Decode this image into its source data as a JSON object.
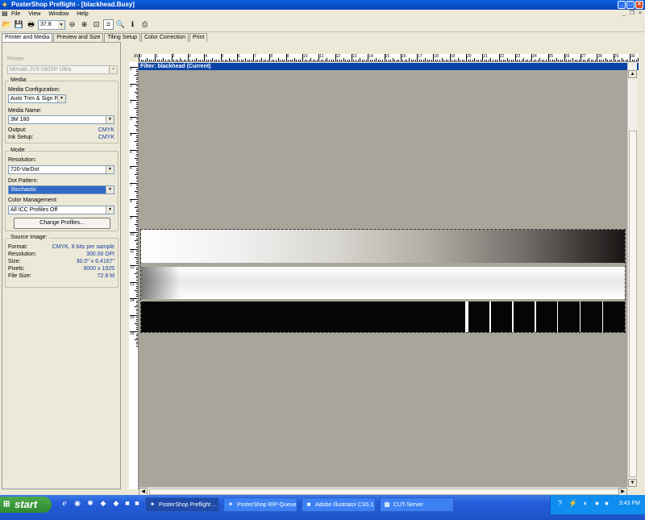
{
  "window": {
    "title": "PosterShop Preflight - [blackhead.Busy]"
  },
  "menu": {
    "items": [
      "File",
      "View",
      "Window",
      "Help"
    ]
  },
  "toolbar": {
    "zoom": "37.8"
  },
  "tabs": [
    "Printer and Media",
    "Preview and Size",
    "Tiling Setup",
    "Color Correction",
    "Print"
  ],
  "printer": {
    "label": "Printer",
    "value": "Mimaki JV3-160SP Ultra"
  },
  "media": {
    "group": "Media:",
    "config_label": "Media Configuration:",
    "config_value": "Auto Trim & Sign Pro",
    "name_label": "Media Name:",
    "name_value": "3M 180",
    "output_label": "Output:",
    "output_value": "CMYK",
    "ink_label": "Ink Setup:",
    "ink_value": "CMYK"
  },
  "mode": {
    "group": "Mode:",
    "resolution_label": "Resolution:",
    "resolution_value": "720-VarDot",
    "dot_label": "Dot Pattern:",
    "dot_value": "Stochastic",
    "cm_label": "Color Management:",
    "cm_value": "All ICC Profiles Off",
    "change_button": "Change Profiles..."
  },
  "source": {
    "group": "Source Image:",
    "rows": [
      {
        "label": "Format:",
        "value": "CMYK, 8 bits per sample"
      },
      {
        "label": "Resolution:",
        "value": "300.00 DPI"
      },
      {
        "label": "Size:",
        "value": "30.0\" x 6.4167\""
      },
      {
        "label": "Pixels:",
        "value": "9000 x 1925"
      },
      {
        "label": "File Size:",
        "value": "72.8 M"
      }
    ]
  },
  "ruler": {
    "unit": "in",
    "h_ticks": [
      "0",
      "1",
      "2",
      "3",
      "4",
      "5",
      "6",
      "7",
      "8",
      "9",
      "10",
      "11",
      "12",
      "13",
      "14",
      "15",
      "16",
      "17",
      "18",
      "19",
      "20",
      "21",
      "22",
      "23",
      "24",
      "25",
      "26",
      "27",
      "28",
      "29",
      "30"
    ],
    "v_ticks": [
      "0",
      "1",
      "2",
      "3",
      "4",
      "5",
      "6",
      "7",
      "8",
      "9",
      "10",
      "11",
      "12",
      "13",
      "14",
      "15",
      "16"
    ]
  },
  "canvas": {
    "header": "Filter: blackhead (Current)"
  },
  "taskbar": {
    "start": "start",
    "tasks": [
      "PosterShop Preflight ...",
      "PosterShop RIP-Queue",
      "Adobe Illustrator CS5.1",
      "CUT-Server"
    ],
    "clock": "3:43 PM"
  }
}
